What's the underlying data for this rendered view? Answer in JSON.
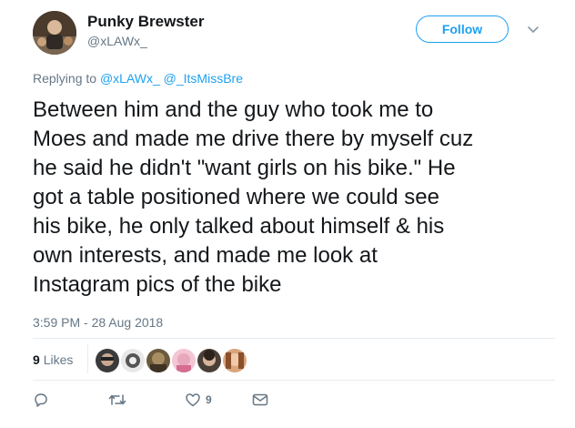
{
  "tweet": {
    "author_name": "Punky Brewster",
    "author_handle": "@xLAWx_",
    "follow_label": "Follow",
    "replying_prefix": "Replying to ",
    "replying_to": [
      "@xLAWx_",
      "@_ItsMissBre"
    ],
    "text_lines": [
      "Between him and the guy who took me to",
      "Moes and made me drive there by myself cuz",
      "he said he didn't \"want girls on his bike.\" He",
      "got a table positioned where we could see",
      "his bike, he only talked about himself & his",
      "own interests, and made me look at",
      "Instagram pics of the bike"
    ],
    "timestamp": "3:59 PM - 28 Aug 2018",
    "likes_count": "9",
    "likes_label": "Likes",
    "like_action_count": "9"
  },
  "icons": {
    "caret": "chevron-down-icon",
    "reply": "reply-icon",
    "retweet": "retweet-icon",
    "like": "heart-icon",
    "message": "envelope-icon"
  },
  "colors": {
    "accent": "#1da1f2",
    "muted": "#657786",
    "text": "#14171a",
    "divider": "#e6ecf0"
  }
}
